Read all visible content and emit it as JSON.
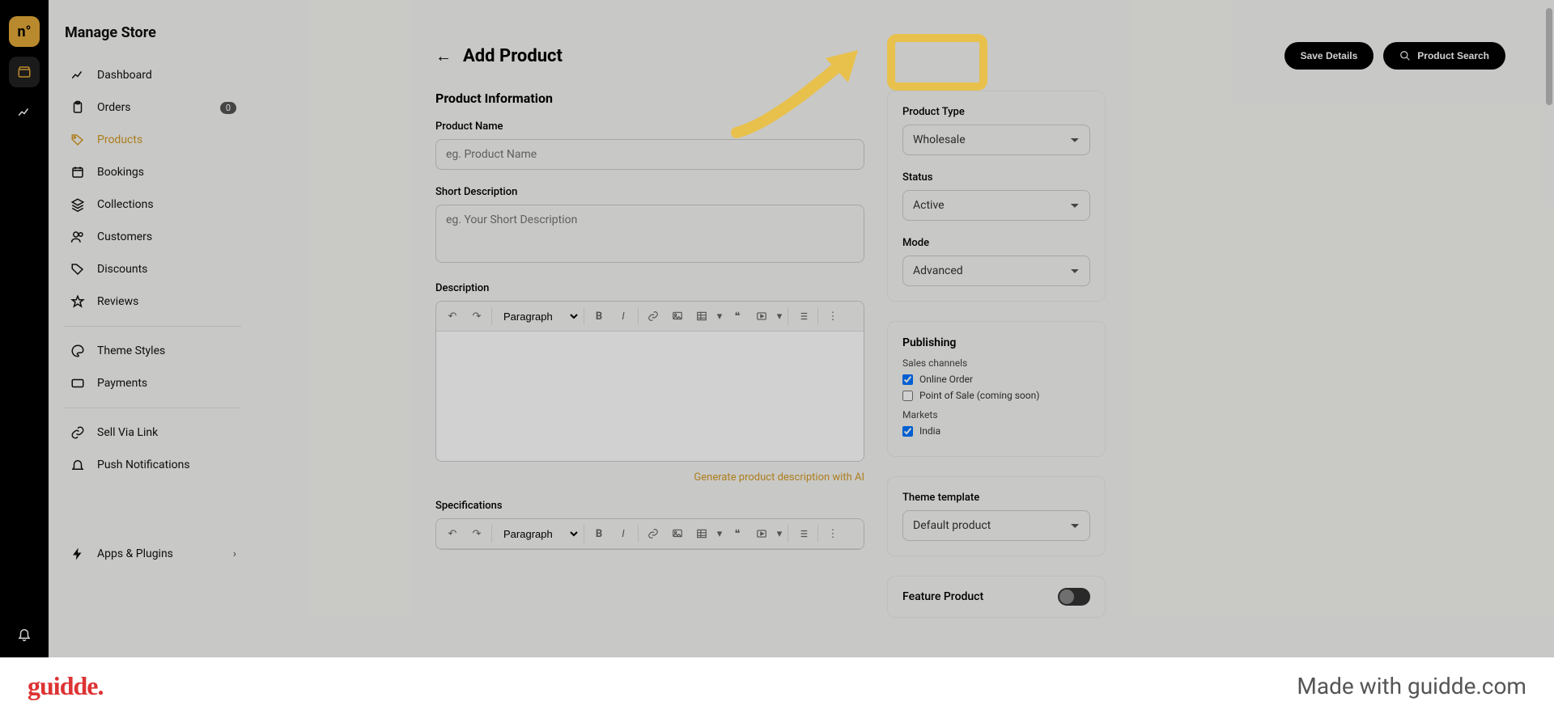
{
  "sidebar": {
    "title": "Manage Store",
    "items": [
      {
        "label": "Dashboard"
      },
      {
        "label": "Orders",
        "badge": "0"
      },
      {
        "label": "Products"
      },
      {
        "label": "Bookings"
      },
      {
        "label": "Collections"
      },
      {
        "label": "Customers"
      },
      {
        "label": "Discounts"
      },
      {
        "label": "Reviews"
      }
    ],
    "group2": [
      {
        "label": "Theme Styles"
      },
      {
        "label": "Payments"
      }
    ],
    "group3": [
      {
        "label": "Sell Via Link"
      },
      {
        "label": "Push Notifications"
      }
    ],
    "apps": "Apps & Plugins"
  },
  "header": {
    "title": "Add Product",
    "save": "Save Details",
    "search": "Product Search"
  },
  "form": {
    "section_title": "Product Information",
    "name_label": "Product Name",
    "name_placeholder": "eg. Product Name",
    "short_label": "Short Description",
    "short_placeholder": "eg. Your Short Description",
    "desc_label": "Description",
    "paragraph": "Paragraph",
    "ai_link": "Generate product description with AI",
    "spec_label": "Specifications"
  },
  "side": {
    "type_label": "Product Type",
    "type_value": "Wholesale",
    "status_label": "Status",
    "status_value": "Active",
    "mode_label": "Mode",
    "mode_value": "Advanced",
    "pub_title": "Publishing",
    "channels_label": "Sales channels",
    "ch_online": "Online Order",
    "ch_pos": "Point of Sale (coming soon)",
    "markets_label": "Markets",
    "mk_india": "India",
    "theme_label": "Theme template",
    "theme_value": "Default product",
    "feature_label": "Feature Product"
  },
  "footer": {
    "brand": "guidde.",
    "made": "Made with guidde.com"
  },
  "rail": {
    "logo_letter": "n°"
  }
}
